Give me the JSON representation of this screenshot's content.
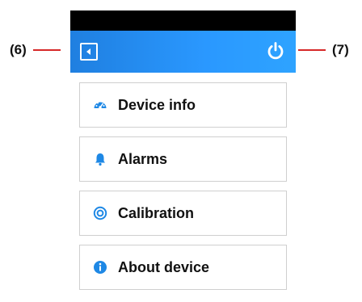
{
  "callouts": {
    "left": "(6)",
    "right": "(7)"
  },
  "colors": {
    "accent": "#2a98ff",
    "callout_line": "#d62828"
  },
  "appbar": {
    "back_icon": "back-square-icon",
    "power_icon": "power-icon"
  },
  "menu": {
    "items": [
      {
        "label": "Device info",
        "icon": "dashboard-gauge-icon"
      },
      {
        "label": "Alarms",
        "icon": "bell-icon"
      },
      {
        "label": "Calibration",
        "icon": "target-icon"
      },
      {
        "label": "About device",
        "icon": "info-circle-icon"
      }
    ]
  }
}
